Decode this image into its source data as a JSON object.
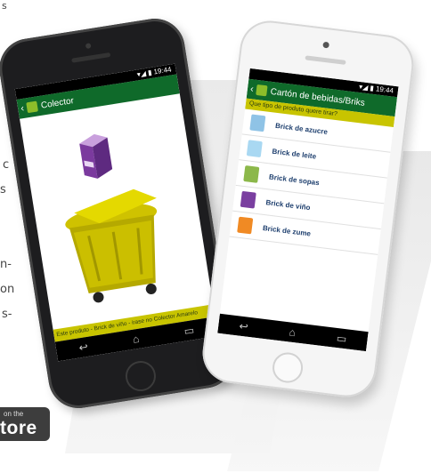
{
  "background_text": {
    "top": "s",
    "c": "c",
    "s": "s",
    "n1": "n-",
    "n2": "on",
    "n3": "s-"
  },
  "store_badge": {
    "small": "on the",
    "big": "tore"
  },
  "left_phone": {
    "status": "19:44",
    "title": "Colector",
    "bottom_message": "Este produto - Brick de viño - irase no Colector Amarelo",
    "nav": [
      "↩",
      "⌂",
      "▭"
    ]
  },
  "right_phone": {
    "status": "19:44",
    "title": "Cartón de bebidas/Briks",
    "question": "Que tipo de produto quere tirar?",
    "items": [
      {
        "label": "Brick de azucre",
        "icon": "sugar-carton-icon",
        "color": "#8fc3e6"
      },
      {
        "label": "Brick de leite",
        "icon": "milk-carton-icon",
        "color": "#a9d8f2"
      },
      {
        "label": "Brick de sopas",
        "icon": "soup-carton-icon",
        "color": "#8cb84a"
      },
      {
        "label": "Brick de viño",
        "icon": "wine-carton-icon",
        "color": "#7a3fa0"
      },
      {
        "label": "Brick de zume",
        "icon": "juice-carton-icon",
        "color": "#f08a24"
      }
    ],
    "nav": [
      "↩",
      "⌂",
      "▭"
    ]
  },
  "colors": {
    "header_green": "#0f6a2a",
    "accent_yellow": "#c8c400",
    "list_text": "#1e3f6e"
  }
}
